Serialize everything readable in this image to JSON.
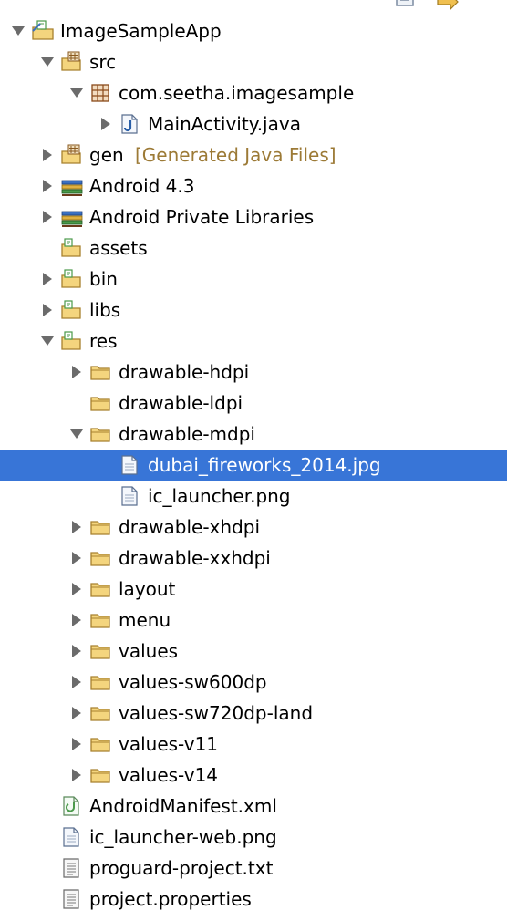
{
  "tree": [
    {
      "id": "imagesampleapp",
      "depth": 0,
      "arrow": "expanded",
      "icon": "project",
      "label": "ImageSampleApp"
    },
    {
      "id": "src",
      "depth": 1,
      "arrow": "expanded",
      "icon": "srcfolder",
      "label": "src"
    },
    {
      "id": "com-seetha-imagesample",
      "depth": 2,
      "arrow": "expanded",
      "icon": "package",
      "label": "com.seetha.imagesample"
    },
    {
      "id": "mainactivity-java",
      "depth": 3,
      "arrow": "collapsed",
      "icon": "javafile",
      "label": "MainActivity.java"
    },
    {
      "id": "gen",
      "depth": 1,
      "arrow": "collapsed",
      "icon": "srcfolder",
      "label": "gen",
      "decoration": "[Generated Java Files]"
    },
    {
      "id": "android-4-3",
      "depth": 1,
      "arrow": "collapsed",
      "icon": "library",
      "label": "Android 4.3"
    },
    {
      "id": "android-private-libraries",
      "depth": 1,
      "arrow": "collapsed",
      "icon": "library",
      "label": "Android Private Libraries"
    },
    {
      "id": "assets",
      "depth": 1,
      "arrow": "none",
      "icon": "projfolder",
      "label": "assets"
    },
    {
      "id": "bin",
      "depth": 1,
      "arrow": "collapsed",
      "icon": "projfolder",
      "label": "bin"
    },
    {
      "id": "libs",
      "depth": 1,
      "arrow": "collapsed",
      "icon": "projfolder",
      "label": "libs"
    },
    {
      "id": "res",
      "depth": 1,
      "arrow": "expanded",
      "icon": "projfolder",
      "label": "res"
    },
    {
      "id": "drawable-hdpi",
      "depth": 2,
      "arrow": "collapsed",
      "icon": "folder",
      "label": "drawable-hdpi"
    },
    {
      "id": "drawable-ldpi",
      "depth": 2,
      "arrow": "none",
      "icon": "folder",
      "label": "drawable-ldpi"
    },
    {
      "id": "drawable-mdpi",
      "depth": 2,
      "arrow": "expanded",
      "icon": "folder",
      "label": "drawable-mdpi"
    },
    {
      "id": "dubai-fireworks-2014-jpg",
      "depth": 3,
      "arrow": "none",
      "icon": "file",
      "label": "dubai_fireworks_2014.jpg",
      "selected": true
    },
    {
      "id": "ic-launcher-png",
      "depth": 3,
      "arrow": "none",
      "icon": "file",
      "label": "ic_launcher.png"
    },
    {
      "id": "drawable-xhdpi",
      "depth": 2,
      "arrow": "collapsed",
      "icon": "folder",
      "label": "drawable-xhdpi"
    },
    {
      "id": "drawable-xxhdpi",
      "depth": 2,
      "arrow": "collapsed",
      "icon": "folder",
      "label": "drawable-xxhdpi"
    },
    {
      "id": "layout",
      "depth": 2,
      "arrow": "collapsed",
      "icon": "folder",
      "label": "layout"
    },
    {
      "id": "menu",
      "depth": 2,
      "arrow": "collapsed",
      "icon": "folder",
      "label": "menu"
    },
    {
      "id": "values",
      "depth": 2,
      "arrow": "collapsed",
      "icon": "folder",
      "label": "values"
    },
    {
      "id": "values-sw600dp",
      "depth": 2,
      "arrow": "collapsed",
      "icon": "folder",
      "label": "values-sw600dp"
    },
    {
      "id": "values-sw720dp-land",
      "depth": 2,
      "arrow": "collapsed",
      "icon": "folder",
      "label": "values-sw720dp-land"
    },
    {
      "id": "values-v11",
      "depth": 2,
      "arrow": "collapsed",
      "icon": "folder",
      "label": "values-v11"
    },
    {
      "id": "values-v14",
      "depth": 2,
      "arrow": "collapsed",
      "icon": "folder",
      "label": "values-v14"
    },
    {
      "id": "androidmanifest-xml",
      "depth": 1,
      "arrow": "none",
      "icon": "manifest",
      "label": "AndroidManifest.xml"
    },
    {
      "id": "ic-launcher-web-png",
      "depth": 1,
      "arrow": "none",
      "icon": "file",
      "label": "ic_launcher-web.png"
    },
    {
      "id": "proguard-project-txt",
      "depth": 1,
      "arrow": "none",
      "icon": "textfile",
      "label": "proguard-project.txt"
    },
    {
      "id": "project-properties",
      "depth": 1,
      "arrow": "none",
      "icon": "textfile",
      "label": "project.properties"
    }
  ],
  "colors": {
    "selection": "#3875d7",
    "decoration": "#9c7a36",
    "folder": "#f4d57e",
    "folder_stroke": "#a8812e",
    "arrow": "#6b6b6b"
  }
}
